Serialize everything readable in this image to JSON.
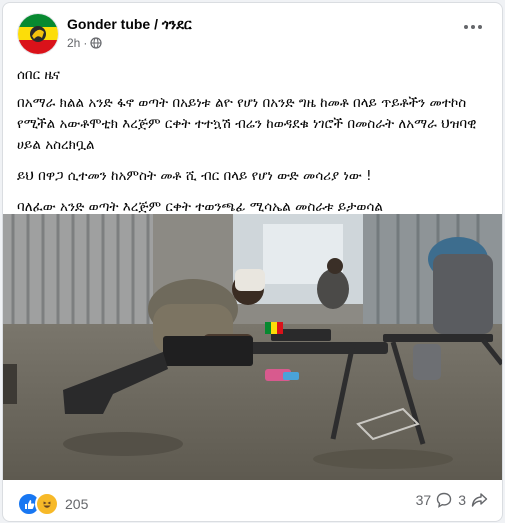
{
  "post": {
    "page_name": "Gonder tube / ጎንደር",
    "time": "2h",
    "dot": "·",
    "paragraphs": [
      "ሰበር ዜና",
      "በአማራ ክልል አንድ ፋኖ ወጣት በአይነቱ ልዮ የሆነ በአንድ ግዜ ከመቶ በላይ ጥይቶችን መተኮስ የሚችል አውቶሞቲክ እረጅም ርቀት ተተኳሽ ብሬን ከወዳደቁ ነገሮች በመስራት ለአማራ ህዝባዊ ሀይል አስረክቧል",
      "ይህ በዋጋ ሲተመን ከአምስት መቶ ሺ ብር በላይ የሆነ ውድ መሳሪያ ነው !",
      "ባለፈው አንድ ወጣት እረጅም ርቀት ተወንጫፊ ሚሳኤል መስራቱ ይታወሳል"
    ]
  },
  "footer": {
    "reaction_count": "205",
    "comment_count": "37",
    "share_count": "3"
  },
  "colors": {
    "like_blue": "#1877f2",
    "haha_yellow": "#f7b928",
    "meta_gray": "#65676b"
  },
  "icons": [
    "flag-avatar-icon",
    "globe-icon",
    "more-icon",
    "like-icon",
    "haha-icon",
    "comment-icon",
    "share-icon"
  ]
}
